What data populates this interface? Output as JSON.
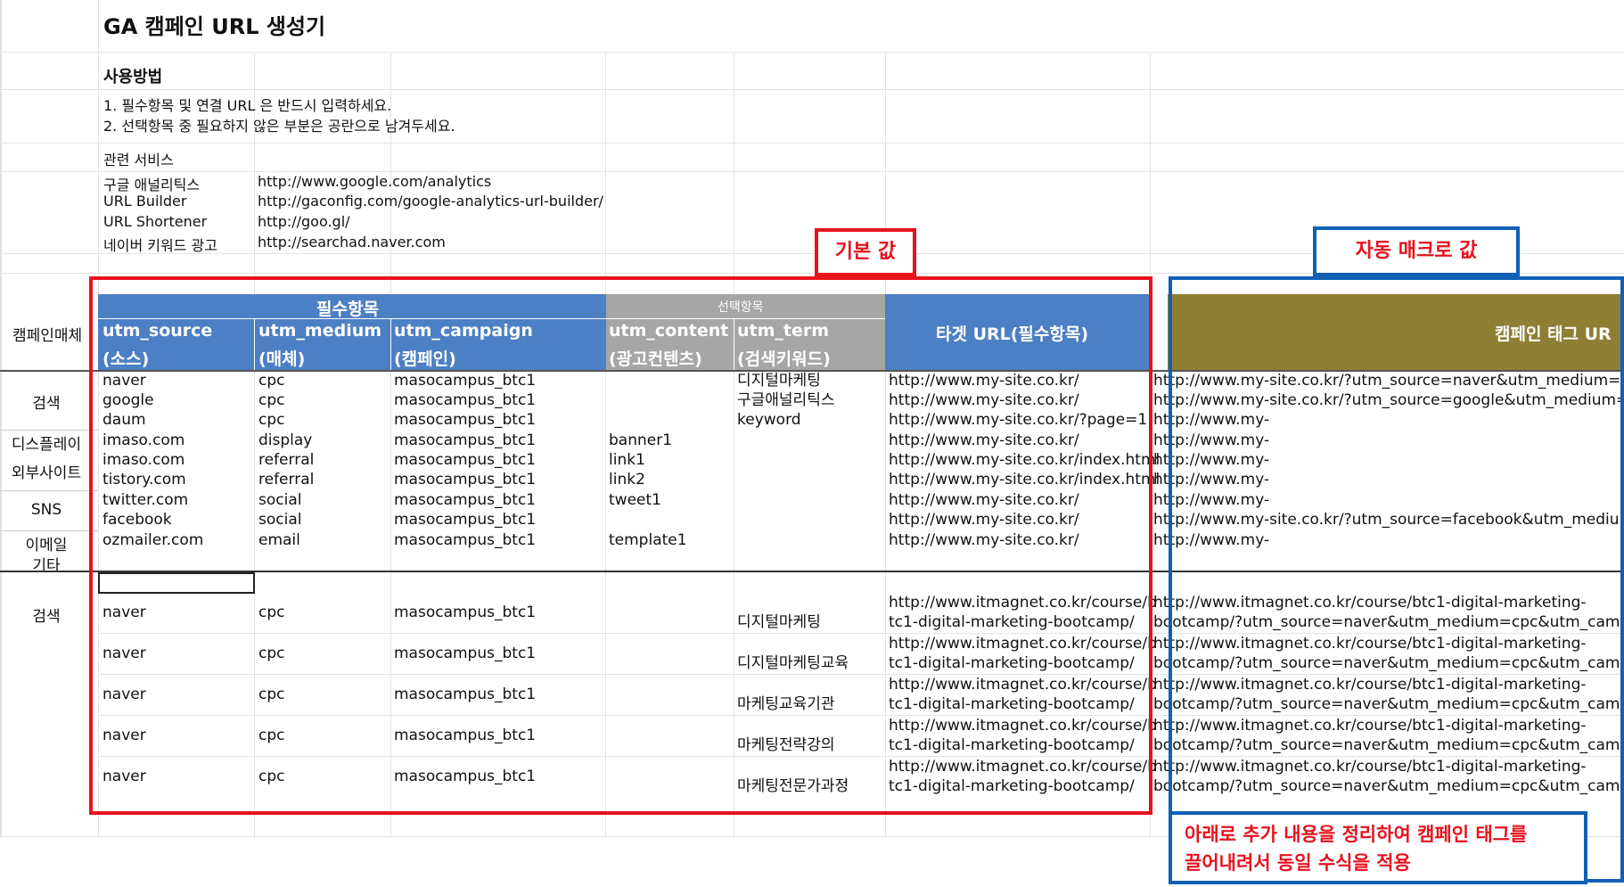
{
  "title": "GA 캠페인 URL 생성기",
  "usage": {
    "heading": "사용방법",
    "line1": "1. 필수항목 및 연결 URL 은 반드시 입력하세요.",
    "line2": "2. 선택항목 중 필요하지 않은 부분은 공란으로 남겨두세요."
  },
  "services": {
    "heading": "관련 서비스",
    "items": [
      {
        "name": "구글 애널리틱스",
        "url": "http://www.google.com/analytics"
      },
      {
        "name": "URL Builder",
        "url": "http://gaconfig.com/google-analytics-url-builder/"
      },
      {
        "name": "URL Shortener",
        "url": "http://goo.gl/"
      },
      {
        "name": "네이버 키워드 광고",
        "url": "http://searchad.naver.com"
      }
    ]
  },
  "callouts": {
    "default_value": "기본 값",
    "macro_value": "자동 매크로 값",
    "note_line1": "아래로 추가 내용을 정리하여 캠페인 태그를",
    "note_line2": "끌어내려서 동일 수식을 적용"
  },
  "header": {
    "group_required": "필수항목",
    "group_optional": "선택항목",
    "col_medium_source": "캠페인매체",
    "source": "utm_source",
    "source_ko": "(소스)",
    "medium": "utm_medium",
    "medium_ko": "(매체)",
    "campaign": "utm_campaign",
    "campaign_ko": "(캠페인)",
    "content": "utm_content",
    "content_ko": "(광고컨텐츠)",
    "term": "utm_term",
    "term_ko": "(검색키워드)",
    "target_url": "타겟 URL(필수항목)",
    "tag_url": "캠페인 태그 UR"
  },
  "categories": {
    "search": "검색",
    "display": "디스플레이",
    "external": "외부사이트",
    "sns": "SNS",
    "email": "이메일",
    "other": "기타",
    "search2": "검색"
  },
  "rows": [
    {
      "source": "naver",
      "medium": "cpc",
      "campaign": "masocampus_btc1",
      "content": "",
      "term": "디지털마케팅",
      "url": "http://www.my-site.co.kr/",
      "tag": "http://www.my-site.co.kr/?utm_source=naver&utm_medium=cpc&"
    },
    {
      "source": "google",
      "medium": "cpc",
      "campaign": "masocampus_btc1",
      "content": "",
      "term": "구글애널리틱스",
      "url": "http://www.my-site.co.kr/",
      "tag": "http://www.my-site.co.kr/?utm_source=google&utm_medium=cpc"
    },
    {
      "source": "daum",
      "medium": "cpc",
      "campaign": "masocampus_btc1",
      "content": "",
      "term": "keyword",
      "url": "http://www.my-site.co.kr/?page=1",
      "tag": "http://www.my-"
    },
    {
      "source": "imaso.com",
      "medium": "display",
      "campaign": "masocampus_btc1",
      "content": "banner1",
      "term": "",
      "url": "http://www.my-site.co.kr/",
      "tag": "http://www.my-"
    },
    {
      "source": "imaso.com",
      "medium": "referral",
      "campaign": "masocampus_btc1",
      "content": "link1",
      "term": "",
      "url": "http://www.my-site.co.kr/index.html",
      "tag": "http://www.my-"
    },
    {
      "source": "tistory.com",
      "medium": "referral",
      "campaign": "masocampus_btc1",
      "content": "link2",
      "term": "",
      "url": "http://www.my-site.co.kr/index.html",
      "tag": "http://www.my-"
    },
    {
      "source": "twitter.com",
      "medium": "social",
      "campaign": "masocampus_btc1",
      "content": "tweet1",
      "term": "",
      "url": "http://www.my-site.co.kr/",
      "tag": "http://www.my-"
    },
    {
      "source": "facebook",
      "medium": "social",
      "campaign": "masocampus_btc1",
      "content": "",
      "term": "",
      "url": "http://www.my-site.co.kr/",
      "tag": "http://www.my-site.co.kr/?utm_source=facebook&utm_medium=s"
    },
    {
      "source": "ozmailer.com",
      "medium": "email",
      "campaign": "masocampus_btc1",
      "content": "template1",
      "term": "",
      "url": "http://www.my-site.co.kr/",
      "tag": "http://www.my-"
    }
  ],
  "rows2": [
    {
      "source": "naver",
      "medium": "cpc",
      "campaign": "masocampus_btc1",
      "term": "디지털마케팅",
      "url1": "http://www.itmagnet.co.kr/course/b",
      "url2": "tc1-digital-marketing-bootcamp/",
      "tag1": "http://www.itmagnet.co.kr/course/btc1-digital-marketing-",
      "tag2": "bootcamp/?utm_source=naver&utm_medium=cpc&utm_campaig"
    },
    {
      "source": "naver",
      "medium": "cpc",
      "campaign": "masocampus_btc1",
      "term": "디지털마케팅교육",
      "url1": "http://www.itmagnet.co.kr/course/b",
      "url2": "tc1-digital-marketing-bootcamp/",
      "tag1": "http://www.itmagnet.co.kr/course/btc1-digital-marketing-",
      "tag2": "bootcamp/?utm_source=naver&utm_medium=cpc&utm_campaig"
    },
    {
      "source": "naver",
      "medium": "cpc",
      "campaign": "masocampus_btc1",
      "term": "마케팅교육기관",
      "url1": "http://www.itmagnet.co.kr/course/b",
      "url2": "tc1-digital-marketing-bootcamp/",
      "tag1": "http://www.itmagnet.co.kr/course/btc1-digital-marketing-",
      "tag2": "bootcamp/?utm_source=naver&utm_medium=cpc&utm_campaig"
    },
    {
      "source": "naver",
      "medium": "cpc",
      "campaign": "masocampus_btc1",
      "term": "마케팅전략강의",
      "url1": "http://www.itmagnet.co.kr/course/b",
      "url2": "tc1-digital-marketing-bootcamp/",
      "tag1": "http://www.itmagnet.co.kr/course/btc1-digital-marketing-",
      "tag2": "bootcamp/?utm_source=naver&utm_medium=cpc&utm_campaig"
    },
    {
      "source": "naver",
      "medium": "cpc",
      "campaign": "masocampus_btc1",
      "term": "마케팅전문가과정",
      "url1": "http://www.itmagnet.co.kr/course/b",
      "url2": "tc1-digital-marketing-bootcamp/",
      "tag1": "http://www.itmagnet.co.kr/course/btc1-digital-marketing-",
      "tag2": "bootcamp/?utm_source=naver&utm_medium=cpc&utm_campaig"
    }
  ],
  "colors": {
    "header_blue": "#4c7fc4",
    "header_gray": "#a6a6a6",
    "header_olive": "#8f7f35",
    "callout_red": "#e8121d",
    "callout_blue": "#1060b6"
  }
}
